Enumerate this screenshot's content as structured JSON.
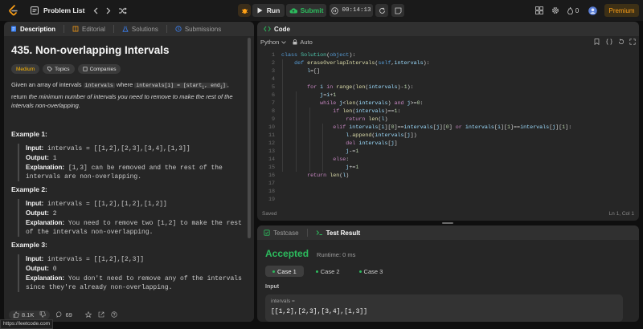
{
  "topbar": {
    "problem_list": "Problem List",
    "run": "Run",
    "submit": "Submit",
    "timer": "00:14:13",
    "fire_count": "0",
    "premium": "Premium"
  },
  "left": {
    "tabs": [
      "Description",
      "Editorial",
      "Solutions",
      "Submissions"
    ],
    "title": "435. Non-overlapping Intervals",
    "tags": [
      "Medium",
      "Topics",
      "Companies"
    ],
    "desc": {
      "p1": "Given an array of intervals",
      "c1": "intervals",
      "p2": "where",
      "c2": "intervals[i] = [start",
      "sub_i": "i",
      "c2b": ", end",
      "c2c": "]",
      "p3": ", return",
      "p4": "the minimum number of intervals you need to remove to make the rest of the intervals non-overlapping."
    },
    "examples": [
      {
        "title": "Example 1:",
        "input": "intervals = [[1,2],[2,3],[3,4],[1,3]]",
        "output": "1",
        "explanation": "[1,3] can be removed and the rest of the intervals are non-overlapping."
      },
      {
        "title": "Example 2:",
        "input": "intervals = [[1,2],[1,2],[1,2]]",
        "output": "2",
        "explanation": "You need to remove two [1,2] to make the rest of the intervals non-overlapping."
      },
      {
        "title": "Example 3:",
        "input": "intervals = [[1,2],[2,3]]",
        "output": "0",
        "explanation": "You don't need to remove any of the intervals since they're already non-overlapping."
      }
    ],
    "labels": {
      "input": "Input:",
      "output": "Output:",
      "explanation": "Explanation:"
    },
    "bottom": {
      "likes": "8.1K",
      "comments": "69"
    },
    "status_url": "https://leetcode.com"
  },
  "code": {
    "title": "Code",
    "language": "Python",
    "auto": "Auto",
    "saved": "Saved",
    "cursor": "Ln 1, Col 1",
    "lines": [
      "class Solution(object):",
      "    def eraseOverlapIntervals(self,intervals):",
      "        l=[]",
      "",
      "        for i in range(len(intervals)-1):",
      "            j=i+1",
      "            while j<len(intervals) and j>=0:",
      "                if len(intervals)==1:",
      "                    return len(l)",
      "                elif intervals[i][0]==intervals[j][0] or intervals[i][1]==intervals[j][1]:",
      "                    l.append(intervals[j])",
      "                    del intervals[j]",
      "                    j-=1",
      "                else:",
      "                    j+=1",
      "        return len(l)",
      "",
      "",
      ""
    ]
  },
  "result": {
    "tab_testcase": "Testcase",
    "tab_result": "Test Result",
    "status": "Accepted",
    "runtime": "Runtime: 0 ms",
    "cases": [
      "Case 1",
      "Case 2",
      "Case 3"
    ],
    "input_label": "Input",
    "input_var": "intervals =",
    "input_value": "[[1,2],[2,3],[3,4],[1,3]]"
  },
  "colors": {
    "accent_green": "#2cbb5d",
    "accent_orange": "#ffa116",
    "medium_color": "#ffb800"
  }
}
